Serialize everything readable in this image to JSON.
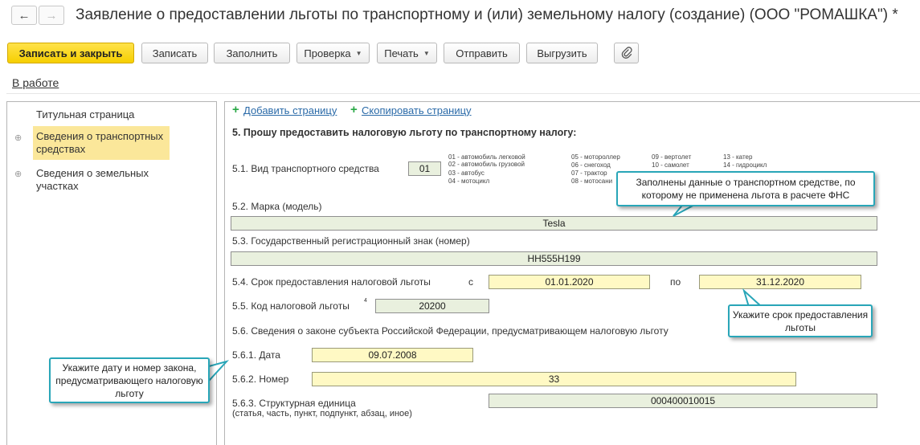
{
  "window": {
    "back_icon": "arrow-left-icon",
    "forward_icon": "arrow-right-icon",
    "title": "Заявление о предоставлении льготы по транспортному и (или) земельному налогу (создание) (ООО \"РОМАШКА\") *"
  },
  "toolbar": {
    "save_close": "Записать и закрыть",
    "save": "Записать",
    "fill": "Заполнить",
    "check": "Проверка",
    "print": "Печать",
    "send": "Отправить",
    "export": "Выгрузить",
    "attach_icon": "paperclip-icon"
  },
  "status": "В работе",
  "sidebar": {
    "items": [
      {
        "label": "Титульная страница"
      },
      {
        "label": "Сведения о транспортных средствах"
      },
      {
        "label": "Сведения о земельных участках"
      }
    ]
  },
  "form": {
    "add_page": "Добавить страницу",
    "copy_page": "Скопировать страницу",
    "section5": "5. Прошу предоставить налоговую льготу по транспортному налогу:",
    "vehicle_type_label": "5.1. Вид транспортного средства",
    "vehicle_type_value": "01",
    "vehicle_codes": [
      "01 - автомобиль легковой",
      "02 - автомобиль грузовой",
      "03 - автобус",
      "04 - мотоцикл",
      "05 - мотороллер",
      "06 - снегоход",
      "07 - трактор",
      "08 - мотосани",
      "09 - вертолет",
      "10 - самолет",
      "13 - катер",
      "14 - гидроцикл"
    ],
    "brand_label": "5.2. Марка (модель)",
    "brand_value": "Tesla",
    "regnum_label": "5.3. Государственный регистрационный знак (номер)",
    "regnum_value": "НН555Н199",
    "period_label": "5.4. Срок предоставления налоговой льготы",
    "from_label": "с",
    "from_value": "01.01.2020",
    "to_label": "по",
    "to_value": "31.12.2020",
    "code_label": "5.5. Код налоговой льготы",
    "code_sup": "4",
    "code_value": "20200",
    "law_label": "5.6. Сведения о законе субъекта Российской Федерации, предусматривающем налоговую льготу",
    "law_date_label": "5.6.1. Дата",
    "law_date_value": "09.07.2008",
    "law_number_label": "5.6.2. Номер",
    "law_number_value": "33",
    "law_unit_label": "5.6.3. Структурная единица",
    "law_unit_sub": "(статья, часть, пункт, подпункт, абзац, иное)",
    "law_unit_value": "000400010015"
  },
  "callouts": {
    "vehicle": "Заполнены данные о транспортном средстве, по которому не применена льгота в расчете ФНС",
    "period": "Укажите срок предоставления льготы",
    "law": "Укажите дату и номер закона, предусматривающего налоговую льготу"
  },
  "colors": {
    "primary_button": "#f6cf00",
    "active_nav": "#fbe79a",
    "field_green": "#e9f0de",
    "field_yellow": "#fff9c4",
    "callout_border": "#29a6b8",
    "link": "#2a6aa8"
  }
}
